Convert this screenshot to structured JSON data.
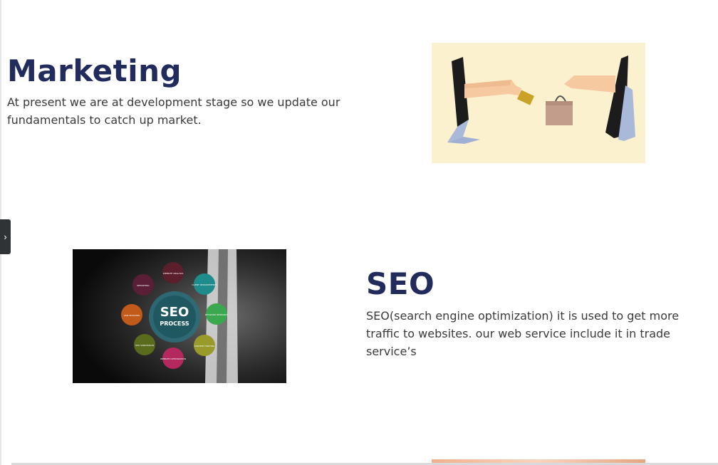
{
  "sections": {
    "marketing": {
      "title": "Marketing",
      "description": "At present we are at development stage so we update our fundamentals to catch up market."
    },
    "seo": {
      "title": "SEO",
      "description": "SEO(search engine optimization) it is used to get more traffic to websites. our web service include it in trade service’s",
      "image_text": {
        "center": "SEO",
        "center_sub": "PROCESS",
        "bubbles": [
          "WEBSITE ANALYSIS",
          "CLIENT REQUIREMENTS",
          "KEYWORD RESEARCH",
          "CONTENT WRITING",
          "WEBSITE OPTIMIZATION",
          "SEO SUBMISSION",
          "LINK BUILDING",
          "REPORTING"
        ]
      }
    }
  },
  "sidebar_toggle": {
    "icon": "chevron-right-icon",
    "glyph": "›"
  },
  "colors": {
    "heading": "#212b5c",
    "text": "#3a3a3a",
    "toggle_bg": "#2f3336"
  }
}
